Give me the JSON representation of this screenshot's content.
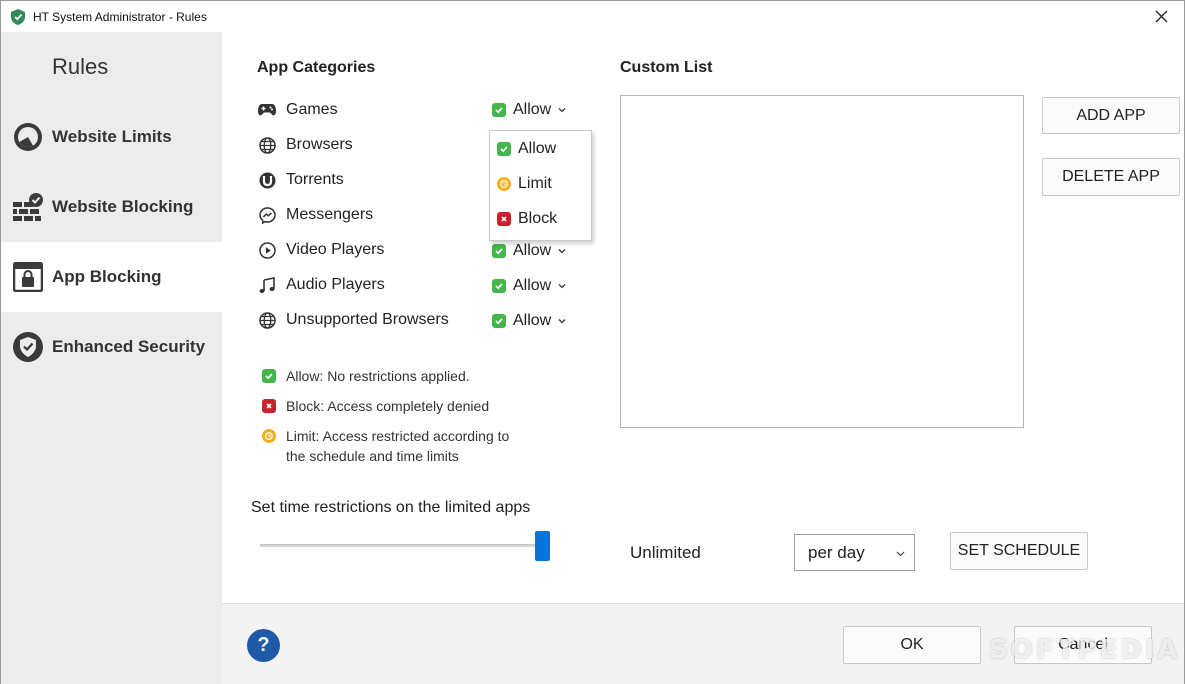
{
  "window": {
    "title": "HT System Administrator - Rules"
  },
  "sidebar": {
    "heading": "Rules",
    "items": [
      {
        "label": "Website Limits",
        "icon": "clock-icon",
        "active": false
      },
      {
        "label": "Website Blocking",
        "icon": "brick-wall-check-icon",
        "active": false
      },
      {
        "label": "App Blocking",
        "icon": "window-lock-icon",
        "active": true
      },
      {
        "label": "Enhanced Security",
        "icon": "shield-check-icon",
        "active": false
      }
    ]
  },
  "categories": {
    "title": "App Categories",
    "rows": [
      {
        "label": "Games",
        "icon": "gamepad-icon",
        "status": "Allow"
      },
      {
        "label": "Browsers",
        "icon": "globe-icon",
        "status": ""
      },
      {
        "label": "Torrents",
        "icon": "utorrent-icon",
        "status": ""
      },
      {
        "label": "Messengers",
        "icon": "messenger-icon",
        "status": ""
      },
      {
        "label": "Video Players",
        "icon": "play-circle-icon",
        "status": "Allow"
      },
      {
        "label": "Audio Players",
        "icon": "music-note-icon",
        "status": "Allow"
      },
      {
        "label": "Unsupported Browsers",
        "icon": "globe-icon",
        "status": "Allow"
      }
    ]
  },
  "dropdown_popup": {
    "options": [
      "Allow",
      "Limit",
      "Block"
    ]
  },
  "legend": {
    "allow": "Allow: No restrictions applied.",
    "block": "Block: Access completely denied",
    "limit_line1": "Limit: Access restricted according to",
    "limit_line2": "the schedule and time limits"
  },
  "custom_list": {
    "title": "Custom List",
    "add_button": "ADD APP",
    "delete_button": "DELETE APP"
  },
  "time_restrictions": {
    "label": "Set time restrictions on the limited apps",
    "slider_level": 1.0,
    "value_text": "Unlimited",
    "period": "per day",
    "schedule_button": "SET SCHEDULE"
  },
  "footer": {
    "help": "?",
    "ok": "OK",
    "cancel": "Cancel",
    "watermark": "SOFTPEDIA"
  },
  "colors": {
    "allow": "#44b64a",
    "block": "#c8222a",
    "limit": "#f0b020",
    "accent": "#0a74d6",
    "help": "#1f5aa8"
  }
}
